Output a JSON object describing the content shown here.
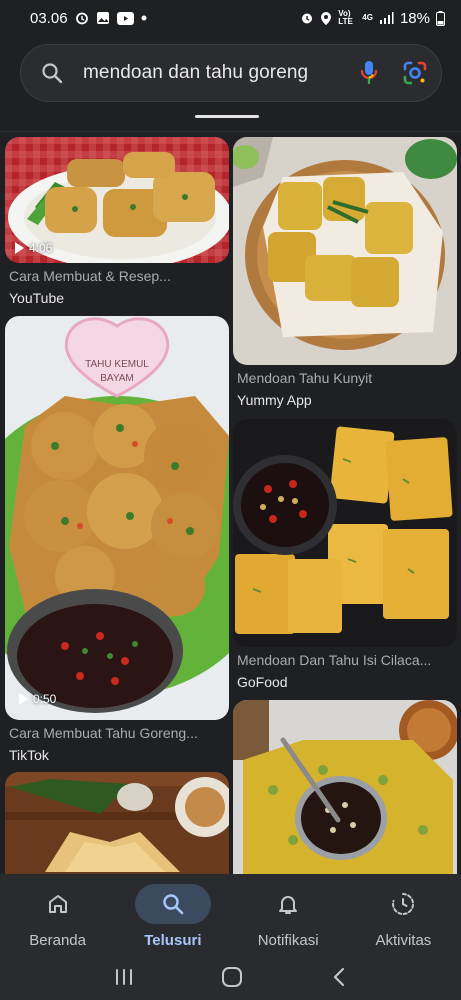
{
  "status_bar": {
    "time": "03.06",
    "network_label": "4G",
    "volte_label": "Vo) LTE",
    "battery": "18%"
  },
  "search": {
    "query": "mendoan dan tahu goreng"
  },
  "results": [
    {
      "title": "Cara Membuat & Resep...",
      "source": "YouTube",
      "duration": "4:06"
    },
    {
      "title": "Mendoan Tahu Kunyit",
      "source": "Yummy App"
    },
    {
      "title": "Cara Membuat Tahu Goreng...",
      "source": "TikTok",
      "duration": "0:50",
      "overlay_text": "TAHU KEMUL BAYAM"
    },
    {
      "title": "Mendoan Dan Tahu Isi Cilaca...",
      "source": "GoFood"
    }
  ],
  "bottom_nav": {
    "items": [
      {
        "label": "Beranda",
        "icon": "home-icon"
      },
      {
        "label": "Telusuri",
        "icon": "search-icon",
        "active": true
      },
      {
        "label": "Notifikasi",
        "icon": "bell-icon"
      },
      {
        "label": "Aktivitas",
        "icon": "activity-icon"
      }
    ]
  },
  "colors": {
    "background": "#1f2023",
    "active_nav": "#a8c7fa",
    "active_pill": "#3b4a5e"
  }
}
